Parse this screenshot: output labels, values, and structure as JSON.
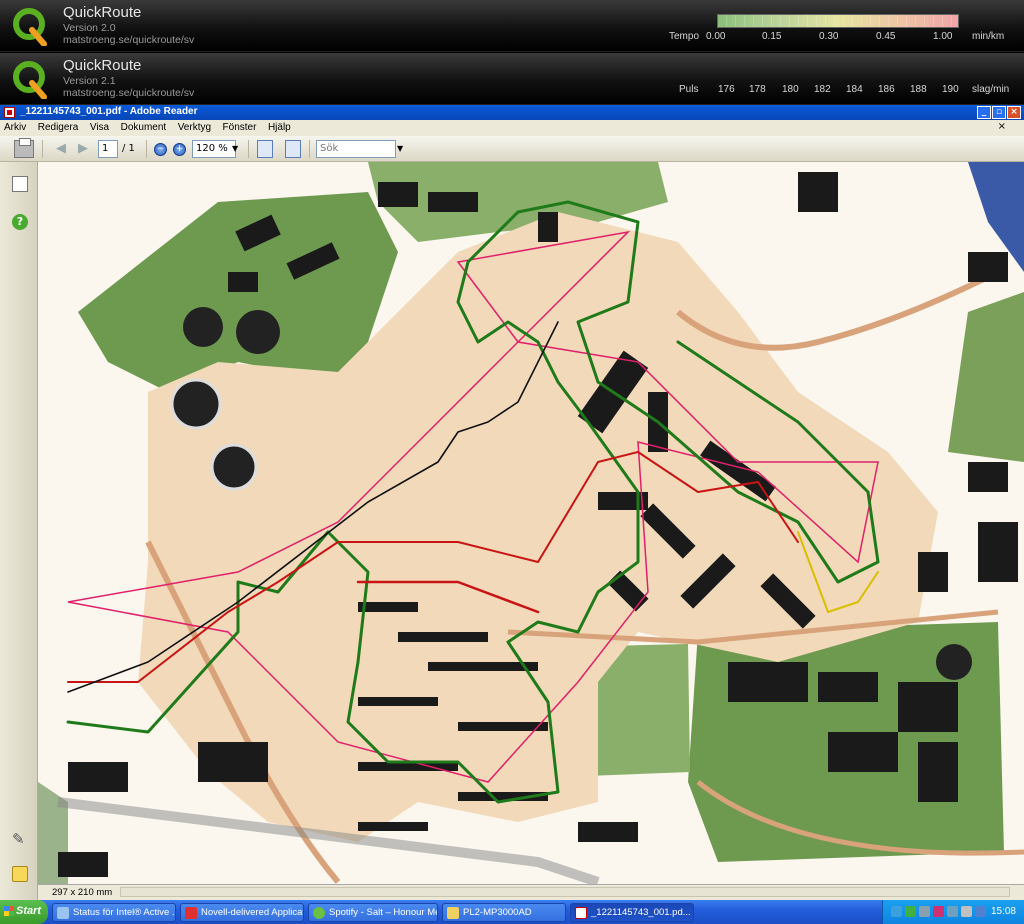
{
  "quickroute_top": {
    "app_name": "QuickRoute",
    "version": "Version 2.0",
    "url": "matstroeng.se/quickroute/sv",
    "scale_label": "Tempo",
    "scale_ticks": [
      "0.00",
      "0.15",
      "0.30",
      "0.45",
      "1.00"
    ],
    "scale_unit": "min/km"
  },
  "quickroute_bottom": {
    "app_name": "QuickRoute",
    "version": "Version 2.1",
    "url": "matstroeng.se/quickroute/sv",
    "scale_label": "Puls",
    "scale_ticks": [
      "176",
      "178",
      "180",
      "182",
      "184",
      "186",
      "188",
      "190"
    ],
    "scale_unit": "slag/min"
  },
  "reader": {
    "title": "_1221145743_001.pdf - Adobe Reader",
    "menu": [
      "Arkiv",
      "Redigera",
      "Visa",
      "Dokument",
      "Verktyg",
      "Fönster",
      "Hjälp"
    ],
    "page_current": "1",
    "page_total": "/ 1",
    "zoom": "120 %",
    "search_placeholder": "Sök",
    "page_size": "297 x 210 mm"
  },
  "taskbar": {
    "start_label": "Start",
    "tasks": [
      "Status för Intel® Active ...",
      "Novell-delivered Applicati...",
      "Spotify - Salt – Honour Me",
      "PL2-MP3000AD",
      "_1221145743_001.pd..."
    ],
    "clock": "15:08"
  },
  "colors": {
    "route_green": "#1f7a1a",
    "route_red": "#c81414",
    "course_magenta": "#e0206a",
    "map_green": "#6e9a50"
  }
}
